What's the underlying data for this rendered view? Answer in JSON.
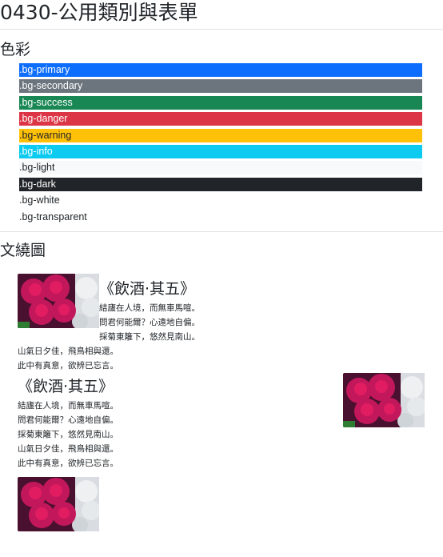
{
  "page": {
    "title": "0430-公用類別與表單",
    "section_colors": "色彩",
    "section_wrap": "文繞圖"
  },
  "colors": [
    {
      "label": ".bg-primary",
      "bg": "#0d6efd",
      "text": "light"
    },
    {
      "label": ".bg-secondary",
      "bg": "#6c757d",
      "text": "light"
    },
    {
      "label": ".bg-success",
      "bg": "#198754",
      "text": "light"
    },
    {
      "label": ".bg-danger",
      "bg": "#dc3545",
      "text": "light"
    },
    {
      "label": ".bg-warning",
      "bg": "#ffc107",
      "text": "dark"
    },
    {
      "label": ".bg-info",
      "bg": "#0dcaf0",
      "text": "light"
    },
    {
      "label": ".bg-light",
      "bg": "#f8f9fa",
      "text": "dark"
    },
    {
      "label": ".bg-dark",
      "bg": "#212529",
      "text": "light"
    },
    {
      "label": ".bg-white",
      "bg": "#ffffff",
      "text": "dark"
    },
    {
      "label": ".bg-transparent",
      "bg": "transparent",
      "text": "dark"
    }
  ],
  "poem": {
    "title": "《飲酒‧其五》",
    "lines": [
      "結廬在人境，而無車馬喧。",
      "問君何能爾？心遠地自偏。",
      "採菊東籬下，悠然見南山。",
      "山氣日夕佳，飛鳥相與還。",
      "此中有真意，欲辨已忘言。"
    ]
  }
}
